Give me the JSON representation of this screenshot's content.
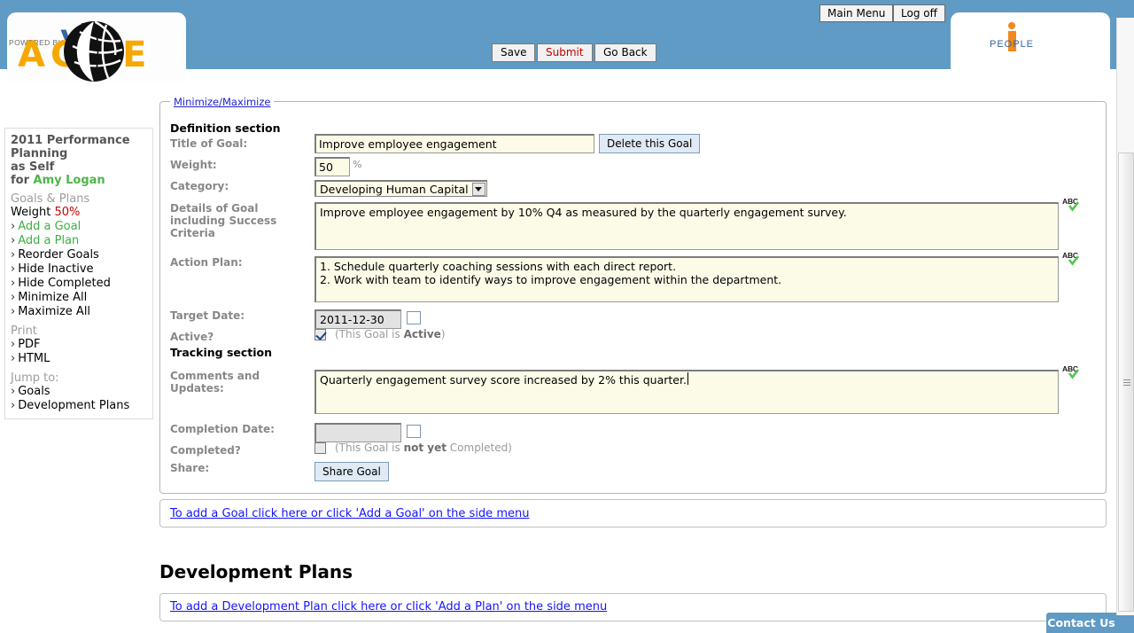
{
  "brand": {
    "logo_text": "ACME",
    "logo_icon": "globe-icon",
    "powered_by": "POWERED BY",
    "via_word": "via",
    "via_people": "PEOPLE"
  },
  "topnav": {
    "main_menu": "Main Menu",
    "log_off": "Log off"
  },
  "toolbar": {
    "save": "Save",
    "submit": "Submit",
    "go_back": "Go Back"
  },
  "sidebar": {
    "title_line1": "2011 Performance",
    "title_line2": "Planning",
    "as_label": "as",
    "as_value": "Self",
    "for_label": "for",
    "for_value": "Amy Logan",
    "section_goals": "Goals & Plans",
    "weight_label": "Weight",
    "weight_value": "50%",
    "items": [
      {
        "label": "Add a Goal",
        "green": true
      },
      {
        "label": "Add a Plan",
        "green": true
      },
      {
        "label": "Reorder Goals",
        "green": false
      },
      {
        "label": "Hide Inactive",
        "green": false
      },
      {
        "label": "Hide Completed",
        "green": false
      },
      {
        "label": "Minimize All",
        "green": false
      },
      {
        "label": "Maximize All",
        "green": false
      }
    ],
    "section_print": "Print",
    "print_items": [
      {
        "label": "PDF"
      },
      {
        "label": "HTML"
      }
    ],
    "section_jump": "Jump to:",
    "jump_items": [
      {
        "label": "Goals"
      },
      {
        "label": "Development Plans"
      }
    ]
  },
  "panel": {
    "legend": "Minimize/Maximize",
    "definition_section": "Definition section",
    "tracking_section": "Tracking section",
    "labels": {
      "title_of_goal": "Title of Goal:",
      "weight": "Weight:",
      "category": "Category:",
      "details": "Details of Goal including Success Criteria",
      "action_plan": "Action Plan:",
      "target_date": "Target Date:",
      "active": "Active?",
      "comments": "Comments and Updates:",
      "completion_date": "Completion Date:",
      "completed": "Completed?",
      "share": "Share:"
    },
    "values": {
      "title_of_goal": "Improve employee engagement",
      "weight": "50",
      "weight_unit": "%",
      "category": "Developing Human Capital",
      "details": "Improve employee engagement by 10% Q4 as measured by the quarterly engagement survey.",
      "action_plan": "1. Schedule quarterly coaching sessions with each direct report.\n2. Work with team to identify ways to improve engagement within the department.",
      "target_date": "2011-12-30",
      "comments": "Quarterly engagement survey score increased by 2% this quarter.",
      "completion_date": ""
    },
    "notes": {
      "active_pre": "(This Goal is ",
      "active_strong": "Active",
      "active_post": ")",
      "completed_pre": "(This Goal is ",
      "completed_strong": "not yet",
      "completed_post": " Completed)"
    },
    "buttons": {
      "delete_goal": "Delete this Goal",
      "share_goal": "Share Goal"
    },
    "spellcheck_label": "ABC"
  },
  "bottom": {
    "add_goal_link": "To add a Goal click here or click 'Add a Goal' on the side menu",
    "development_plans_title": "Development Plans",
    "add_plan_link": "To add a Development Plan click here or click 'Add a Plan' on the side menu"
  },
  "contact": {
    "label": "Contact Us"
  },
  "colors": {
    "header_blue": "#5f9bc4",
    "logo_amber": "#f5a800",
    "green_link": "#3cb043",
    "red_accent": "#cc0000",
    "field_yellow": "#fcfbe7",
    "link_blue": "#1414ff"
  }
}
